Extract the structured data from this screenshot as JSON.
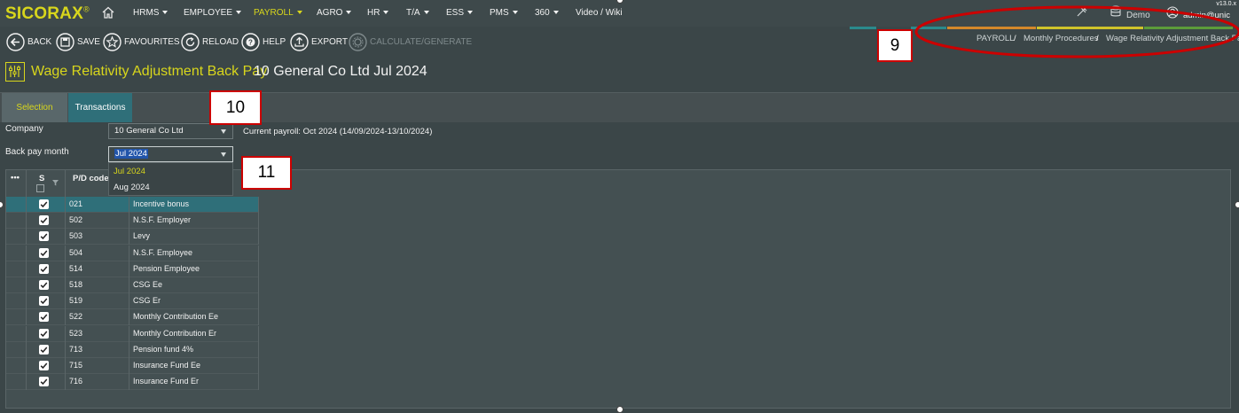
{
  "app": {
    "logo": "SICORAX",
    "logo_mark": "®",
    "version": "v13.0.x"
  },
  "nav": {
    "items": [
      {
        "label": "HRMS"
      },
      {
        "label": "EMPLOYEE"
      },
      {
        "label": "PAYROLL"
      },
      {
        "label": "AGRO"
      },
      {
        "label": "HR"
      },
      {
        "label": "T/A"
      },
      {
        "label": "ESS"
      },
      {
        "label": "PMS"
      },
      {
        "label": "360"
      }
    ],
    "video_wiki": "Video / Wiki",
    "active": "PAYROLL",
    "db_label": "Demo",
    "user": "admin@unic"
  },
  "toolbar": {
    "back": "BACK",
    "save": "SAVE",
    "favourites": "FAVOURITES",
    "reload": "RELOAD",
    "help": "HELP",
    "export": "EXPORT",
    "calculate": "CALCULATE/GENERATE"
  },
  "breadcrumb": {
    "items": [
      "PAYROLL",
      "Monthly Procedures",
      "Wage Relativity Adjustment Back Pay"
    ],
    "separator": "/"
  },
  "page": {
    "title": "Wage Relativity Adjustment Back Pay",
    "subtitle": "10 General Co Ltd Jul 2024"
  },
  "tabs": {
    "selection": "Selection",
    "transactions": "Transactions"
  },
  "form": {
    "company_label": "Company",
    "company_value": "10 General Co Ltd",
    "current_payroll": "Current payroll: Oct 2024 (14/09/2024-13/10/2024)",
    "backpay_label": "Back pay month",
    "backpay_value": "Jul 2024",
    "backpay_options": [
      "Jul 2024",
      "Aug 2024"
    ]
  },
  "grid": {
    "headers": {
      "menu": "•••",
      "select": "S",
      "code": "P/D code"
    },
    "rows": [
      {
        "code": "021",
        "desc": "Incentive bonus",
        "checked": true
      },
      {
        "code": "502",
        "desc": "N.S.F. Employer",
        "checked": true
      },
      {
        "code": "503",
        "desc": "Levy",
        "checked": true
      },
      {
        "code": "504",
        "desc": "N.S.F. Employee",
        "checked": true
      },
      {
        "code": "514",
        "desc": "Pension Employee",
        "checked": true
      },
      {
        "code": "518",
        "desc": "CSG Ee",
        "checked": true
      },
      {
        "code": "519",
        "desc": "CSG Er",
        "checked": true
      },
      {
        "code": "522",
        "desc": "Monthly Contribution Ee",
        "checked": true
      },
      {
        "code": "523",
        "desc": "Monthly Contribution Er",
        "checked": true
      },
      {
        "code": "713",
        "desc": "Pension fund 4%",
        "checked": true
      },
      {
        "code": "715",
        "desc": "Insurance Fund Ee",
        "checked": true
      },
      {
        "code": "716",
        "desc": "Insurance Fund Er",
        "checked": true
      }
    ]
  },
  "annotations": {
    "a9": "9",
    "a10": "10",
    "a11": "11"
  },
  "colors": {
    "accent": "#d8d61c",
    "teal": "#2f6f79",
    "bg": "#3b4648",
    "annotation": "#cc0000"
  }
}
